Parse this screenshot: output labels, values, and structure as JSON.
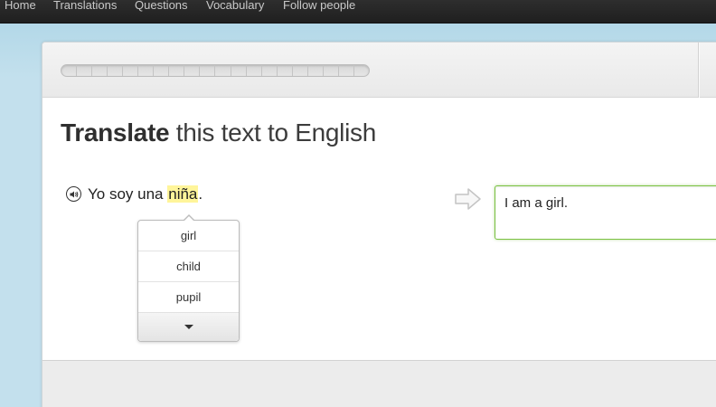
{
  "nav": {
    "items": [
      {
        "label": "Home"
      },
      {
        "label": "Translations"
      },
      {
        "label": "Questions"
      },
      {
        "label": "Vocabulary"
      },
      {
        "label": "Follow people"
      }
    ]
  },
  "lesson": {
    "title_bold": "Translate",
    "title_rest": " this text to English",
    "sentence_before": "Yo soy una ",
    "highlighted_word": "niña",
    "sentence_after": ".",
    "hints": [
      "girl",
      "child",
      "pupil"
    ],
    "answer_value": "I am a girl."
  },
  "colors": {
    "accent_green": "#7ac142",
    "highlight": "#fff59a",
    "nav_bg": "#262626"
  },
  "icons": {
    "speaker": "speaker-icon",
    "arrow": "arrow-right-icon",
    "more": "chevron-down-icon"
  }
}
